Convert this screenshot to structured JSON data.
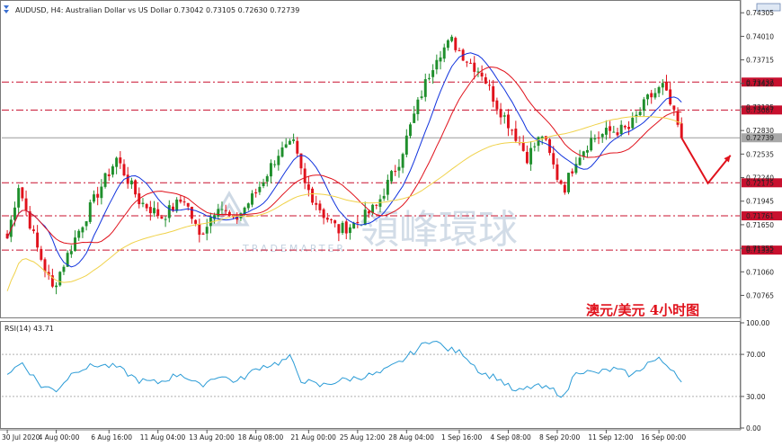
{
  "header": {
    "symbol_text": "AUDUSD, H4:  Australian Dollar vs US Dollar  0.73042 0.73105 0.72630 0.72739"
  },
  "annotation": {
    "text": "澳元/美元  4小时图",
    "color": "#e0121c"
  },
  "watermark": {
    "text": "領峰環球",
    "sub": "TRADEMARTER"
  },
  "rsi_panel": {
    "label": "RSI(14) 43.71"
  },
  "colors": {
    "bull": "#1f8f2c",
    "bear": "#e0121c",
    "ma_fast": "#1133dd",
    "ma_mid": "#e0121c",
    "ma_slow": "#f0d24a",
    "level_line": "#c8102e",
    "rsi_line": "#2a9bd6",
    "last_price": "#9b9b9b"
  },
  "chart_data": [
    {
      "type": "candlestick",
      "title": "AUDUSD, H4",
      "y_ticks": [
        0.74305,
        0.7401,
        0.73715,
        0.7342,
        0.73125,
        0.7283,
        0.72535,
        0.7224,
        0.71945,
        0.7165,
        0.71355,
        0.7106,
        0.70765
      ],
      "ylim": [
        0.705,
        0.7442
      ],
      "x_tick_labels": [
        "30 Jul 2020",
        "4 Aug 00:00",
        "6 Aug 16:00",
        "11 Aug 04:00",
        "13 Aug 20:00",
        "18 Aug 08:00",
        "21 Aug 00:00",
        "25 Aug 12:00",
        "28 Aug 04:00",
        "1 Sep 16:00",
        "4 Sep 08:00",
        "8 Sep 20:00",
        "11 Sep 12:00",
        "16 Sep 00:00"
      ],
      "bars_count": 180,
      "keypoints": [
        [
          0,
          0.7148
        ],
        [
          3,
          0.7215
        ],
        [
          8,
          0.7135
        ],
        [
          12,
          0.7085
        ],
        [
          18,
          0.7148
        ],
        [
          24,
          0.7205
        ],
        [
          29,
          0.7248
        ],
        [
          35,
          0.7195
        ],
        [
          41,
          0.7175
        ],
        [
          47,
          0.7198
        ],
        [
          51,
          0.715
        ],
        [
          56,
          0.7192
        ],
        [
          60,
          0.7168
        ],
        [
          66,
          0.7205
        ],
        [
          72,
          0.7255
        ],
        [
          76,
          0.7265
        ],
        [
          79,
          0.7215
        ],
        [
          84,
          0.7178
        ],
        [
          88,
          0.7158
        ],
        [
          93,
          0.7168
        ],
        [
          98,
          0.7188
        ],
        [
          104,
          0.7245
        ],
        [
          110,
          0.733
        ],
        [
          114,
          0.7378
        ],
        [
          118,
          0.7395
        ],
        [
          122,
          0.7372
        ],
        [
          126,
          0.7355
        ],
        [
          130,
          0.7315
        ],
        [
          134,
          0.7285
        ],
        [
          138,
          0.725
        ],
        [
          142,
          0.7278
        ],
        [
          146,
          0.7225
        ],
        [
          148,
          0.7212
        ],
        [
          151,
          0.7248
        ],
        [
          155,
          0.7272
        ],
        [
          160,
          0.7282
        ],
        [
          165,
          0.7285
        ],
        [
          170,
          0.7322
        ],
        [
          174,
          0.7338
        ],
        [
          176,
          0.7315
        ],
        [
          178,
          0.7288
        ],
        [
          179,
          0.7274
        ]
      ],
      "price_levels": [
        {
          "value": 0.73437,
          "label": "0.73437",
          "style": "dash-dot"
        },
        {
          "value": 0.73087,
          "label": "0.73087",
          "style": "dash-dot"
        },
        {
          "value": 0.72175,
          "label": "0.72175",
          "style": "dash-dot"
        },
        {
          "value": 0.71761,
          "label": "0.71761",
          "style": "dash-dot"
        },
        {
          "value": 0.71332,
          "label": "0.71332",
          "style": "dash-dot"
        }
      ],
      "last_price": {
        "value": 0.72739,
        "label": "0.72739"
      },
      "forecast_arrow": [
        [
          179,
          0.7274
        ],
        [
          186,
          0.7217
        ],
        [
          192,
          0.7252
        ]
      ],
      "moving_averages": [
        {
          "name": "fast",
          "period": 10,
          "color": "#1133dd"
        },
        {
          "name": "mid",
          "period": 20,
          "color": "#e0121c"
        },
        {
          "name": "slow",
          "period": 60,
          "color": "#f0d24a"
        }
      ]
    },
    {
      "type": "line",
      "title": "RSI(14) 43.71",
      "y_ticks": [
        100.0,
        70.0,
        30.0,
        0.0
      ],
      "ylim": [
        0,
        100
      ],
      "levels": [
        70,
        30
      ],
      "last_value": 43.71,
      "keypoints": [
        [
          0,
          52
        ],
        [
          4,
          62
        ],
        [
          9,
          40
        ],
        [
          13,
          36
        ],
        [
          18,
          55
        ],
        [
          24,
          60
        ],
        [
          29,
          58
        ],
        [
          35,
          45
        ],
        [
          40,
          43
        ],
        [
          46,
          52
        ],
        [
          51,
          40
        ],
        [
          56,
          50
        ],
        [
          61,
          44
        ],
        [
          67,
          58
        ],
        [
          72,
          62
        ],
        [
          75,
          67
        ],
        [
          78,
          46
        ],
        [
          83,
          40
        ],
        [
          88,
          45
        ],
        [
          93,
          48
        ],
        [
          99,
          52
        ],
        [
          104,
          62
        ],
        [
          110,
          78
        ],
        [
          113,
          85
        ],
        [
          116,
          76
        ],
        [
          121,
          71
        ],
        [
          126,
          52
        ],
        [
          130,
          48
        ],
        [
          135,
          34
        ],
        [
          140,
          40
        ],
        [
          145,
          36
        ],
        [
          148,
          30
        ],
        [
          151,
          55
        ],
        [
          156,
          52
        ],
        [
          161,
          56
        ],
        [
          166,
          50
        ],
        [
          170,
          62
        ],
        [
          173,
          65
        ],
        [
          176,
          58
        ],
        [
          178,
          51
        ],
        [
          179,
          44
        ]
      ]
    }
  ]
}
